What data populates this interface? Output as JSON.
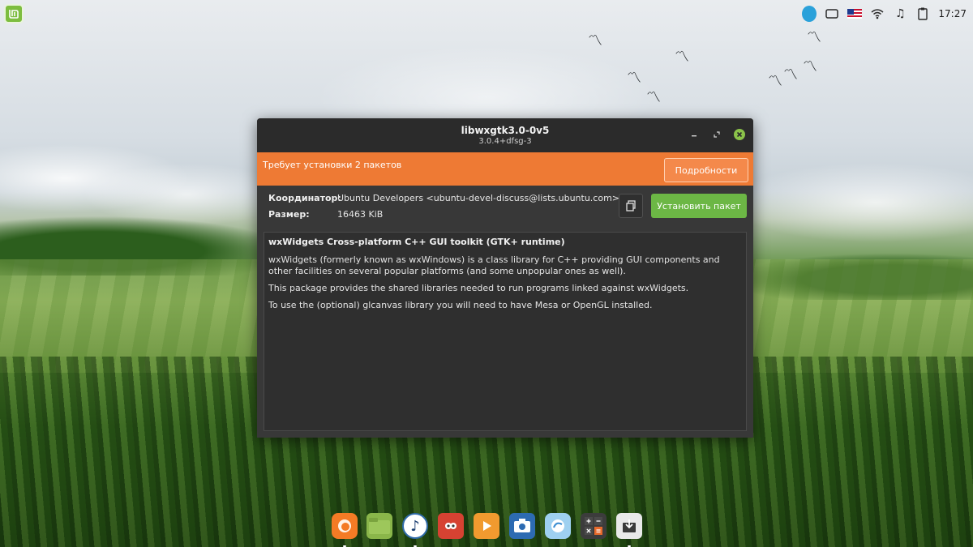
{
  "window": {
    "title": "libwxgtk3.0-0v5",
    "subtitle": "3.0.4+dfsg-3"
  },
  "banner": {
    "message": "Требует установки 2 пакетов",
    "details_label": "Подробности"
  },
  "info": {
    "maintainer_label": "Координатор:",
    "maintainer_value": "Ubuntu Developers <ubuntu-devel-discuss@lists.ubuntu.com>",
    "size_label": "Размер:",
    "size_value": "16463 KiB",
    "install_label": "Установить пакет"
  },
  "description": {
    "heading": "wxWidgets Cross-platform C++ GUI toolkit (GTK+ runtime)",
    "paragraphs": [
      "wxWidgets (formerly known as wxWindows) is a class library for C++ providing GUI components and other facilities on several popular platforms (and some unpopular ones as well).",
      "This package provides the shared libraries needed to run programs linked against wxWidgets.",
      "To use the (optional) glcanvas library you will need to have Mesa or OpenGL installed."
    ]
  },
  "panel": {
    "clock": "17:27"
  },
  "colors": {
    "banner": "#ee7a34",
    "install_button": "#6cb745",
    "window_bg": "#383838",
    "titlebar_bg": "#2b2b2b"
  },
  "dock_icons": [
    "firefox-icon",
    "files-icon",
    "music-player-icon",
    "gimp-icon",
    "media-player-icon",
    "screenshot-icon",
    "browser-icon",
    "calculator-icon",
    "package-installer-icon"
  ]
}
